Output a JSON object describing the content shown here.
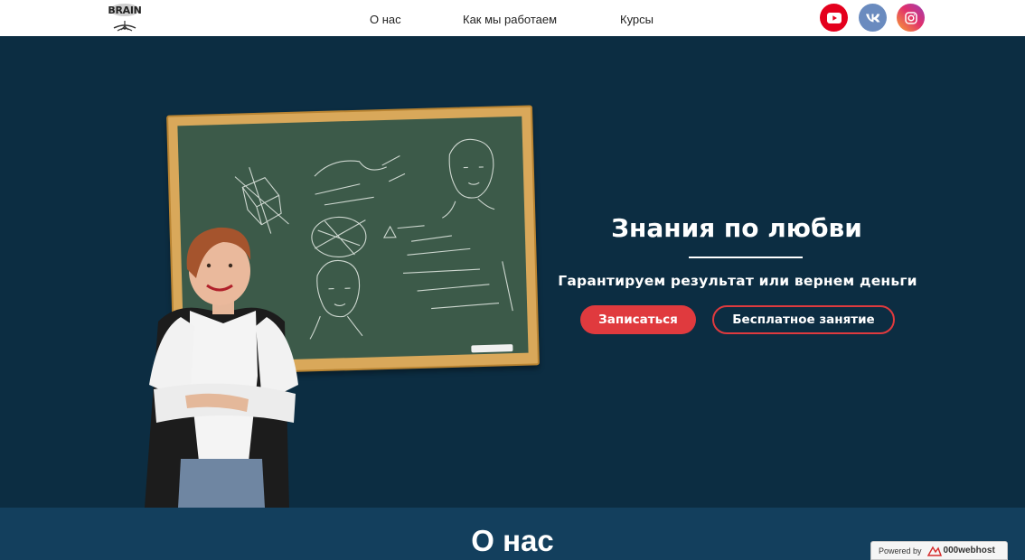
{
  "header": {
    "logo_text": "BRAIN",
    "nav": {
      "about": "О нас",
      "how_we_work": "Как мы работаем",
      "courses": "Курсы"
    },
    "social": {
      "youtube_icon": "youtube-icon",
      "vk_icon": "vk-icon",
      "instagram_icon": "instagram-icon"
    }
  },
  "hero": {
    "title": "Знания по любви",
    "subtitle": "Гарантируем результат или вернем деньги",
    "signup_button": "Записаться",
    "free_lesson_button": "Бесплатное занятие"
  },
  "about": {
    "title": "О нас"
  },
  "footer_badge": {
    "powered_by": "Powered by",
    "host": "000webhost"
  },
  "colors": {
    "accent": "#e03a3e",
    "hero_bg": "#0c2d42",
    "section_bg": "#133f5d",
    "header_bg": "#ffffff",
    "youtube": "#e4001d",
    "vk": "#6a8bbf"
  }
}
